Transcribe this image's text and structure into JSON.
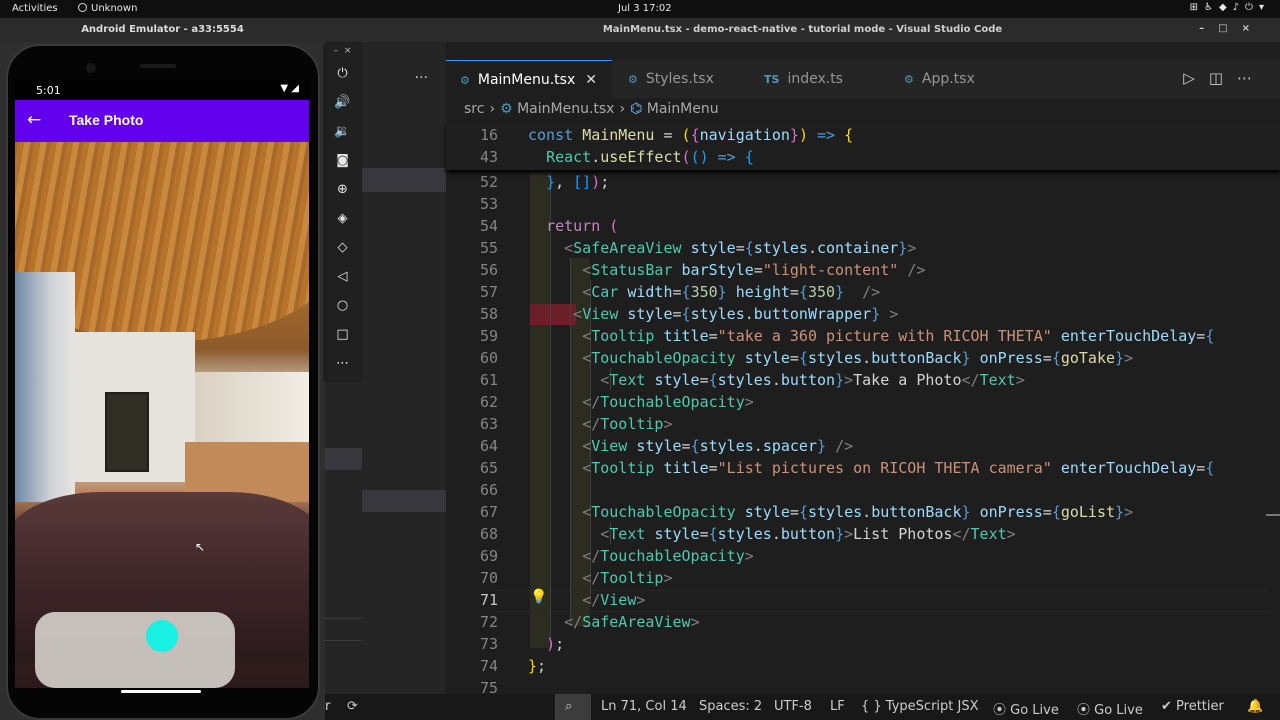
{
  "system": {
    "activities": "Activities",
    "app_name": "Unknown",
    "clock": "Jul 3  17:02"
  },
  "emulator": {
    "title": "Android Emulator - a33:5554",
    "phone": {
      "time": "5:01",
      "app_title": "Take Photo",
      "shutter_color": "#19f0e4",
      "appbar_color": "#6200ee"
    },
    "tools": [
      "power-icon",
      "volume-up-icon",
      "volume-down-icon",
      "camera-icon",
      "zoom-icon",
      "rotate-left-icon",
      "rotate-right-icon",
      "back-icon",
      "home-icon",
      "overview-icon",
      "more-icon"
    ]
  },
  "vscode": {
    "title": "MainMenu.tsx - demo-react-native - tutorial mode - Visual Studio Code",
    "tabs": [
      {
        "label": "MainMenu.tsx",
        "icon": "⚙",
        "active": true
      },
      {
        "label": "Styles.tsx",
        "icon": "⚙",
        "active": false
      },
      {
        "label": "index.ts",
        "icon": "TS",
        "active": false
      },
      {
        "label": "App.tsx",
        "icon": "⚙",
        "active": false
      }
    ],
    "breadcrumb": [
      "src",
      "MainMenu.tsx",
      "MainMenu"
    ],
    "status": {
      "sync_icon": "⟳",
      "position": "Ln 71, Col 14",
      "spaces": "Spaces: 2",
      "encoding": "UTF-8",
      "eol": "LF",
      "language": "{ } TypeScript JSX",
      "golive1": "⦿ Go Live",
      "golive2": "⦿ Go Live",
      "prettier": "✔ Prettier",
      "side_letter": "r"
    },
    "line_numbers": [
      "16",
      "43",
      "52",
      "53",
      "54",
      "55",
      "56",
      "57",
      "58",
      "59",
      "60",
      "61",
      "62",
      "63",
      "64",
      "65",
      "66",
      "67",
      "68",
      "69",
      "70",
      "71",
      "72",
      "73",
      "74",
      "75"
    ],
    "current_line": "71"
  }
}
